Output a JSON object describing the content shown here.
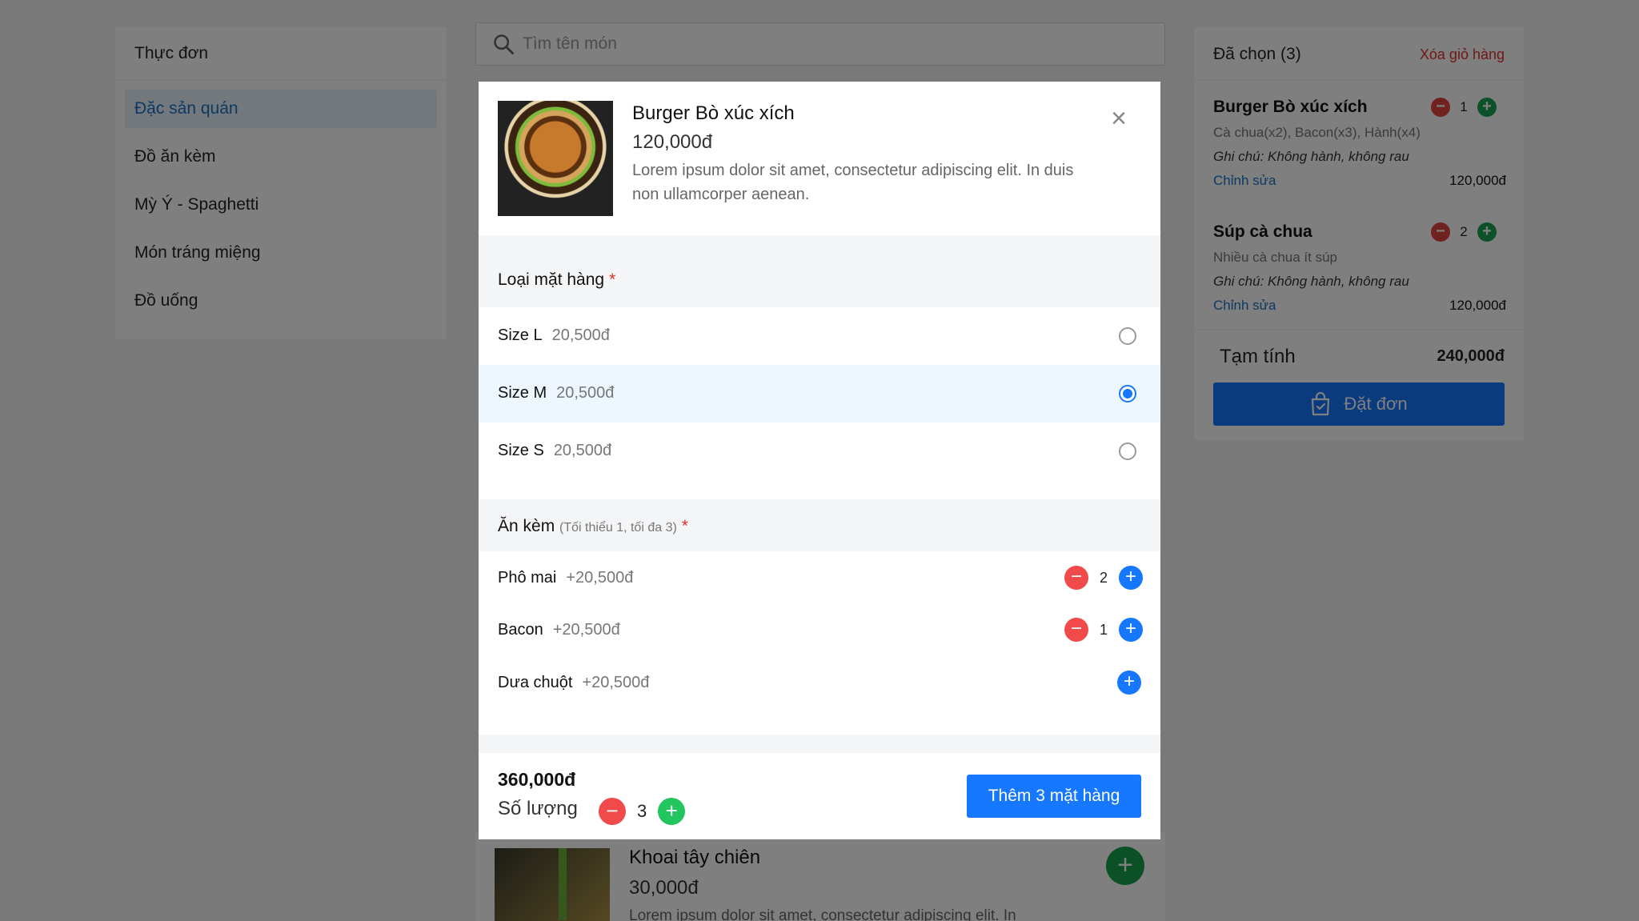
{
  "menu": {
    "title": "Thực đơn",
    "items": [
      "Đặc sản quán",
      "Đồ ăn kèm",
      "Mỳ Ý - Spaghetti",
      "Món tráng miệng",
      "Đồ uống"
    ],
    "active_index": 0
  },
  "search": {
    "placeholder": "Tìm tên món"
  },
  "background_product": {
    "name": "Khoai tây chiên",
    "price": "30,000đ",
    "description": "Lorem ipsum dolor sit amet, consectetur adipiscing elit. In"
  },
  "cart": {
    "title": "Đã chọn (3)",
    "clear_label": "Xóa giỏ hàng",
    "items": [
      {
        "name": "Burger Bò xúc xích",
        "options": "Cà chua(x2), Bacon(x3), Hành(x4)",
        "note": "Ghi chú: Không hành, không rau",
        "edit_label": "Chỉnh sửa",
        "price": "120,000đ",
        "qty": "1"
      },
      {
        "name": "Súp cà chua",
        "options": "Nhiều cà chua ít súp",
        "note": "Ghi chú: Không hành, không rau",
        "edit_label": "Chỉnh sửa",
        "price": "120,000đ",
        "qty": "2"
      }
    ],
    "subtotal_label": "Tạm tính",
    "subtotal_value": "240,000đ",
    "order_label": "Đặt đơn"
  },
  "modal": {
    "name": "Burger Bò xúc xích",
    "price": "120,000đ",
    "description": "Lorem ipsum dolor sit amet, consectetur adipiscing elit. In duis non ullamcorper aenean.",
    "variant_section": {
      "title": "Loại mặt hàng",
      "required_mark": "*"
    },
    "variants": [
      {
        "label": "Size L",
        "price": "20,500đ",
        "selected": false
      },
      {
        "label": "Size M",
        "price": "20,500đ",
        "selected": true
      },
      {
        "label": "Size S",
        "price": "20,500đ",
        "selected": false
      }
    ],
    "addon_section": {
      "title": "Ăn kèm",
      "hint": "(Tối thiểu 1, tối đa 3)",
      "required_mark": "*"
    },
    "addons": [
      {
        "label": "Phô mai",
        "price": "+20,500đ",
        "qty": "2"
      },
      {
        "label": "Bacon",
        "price": "+20,500đ",
        "qty": "1"
      },
      {
        "label": "Dưa chuột",
        "price": "+20,500đ",
        "qty": ""
      }
    ],
    "footer": {
      "total": "360,000đ",
      "qty_label": "Số lượng",
      "qty": "3",
      "add_button_label": "Thêm 3 mặt hàng"
    }
  },
  "colors": {
    "primary": "#1677ff",
    "danger": "#f04a4a",
    "success": "#22c55e",
    "link": "#1a73c8"
  }
}
